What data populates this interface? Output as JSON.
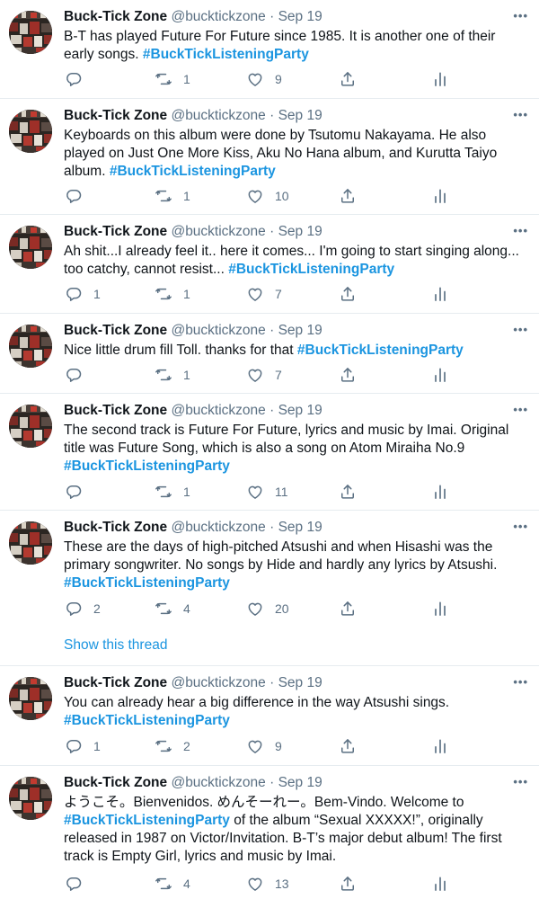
{
  "author": {
    "name": "Buck-Tick Zone",
    "handle": "@bucktickzone",
    "sep": "·",
    "more": "•••"
  },
  "tweets": [
    {
      "date": "Sep 19",
      "lines": [
        [
          {
            "t": "B-T has played Future For Future since 1985. It is another one of their"
          }
        ],
        [
          {
            "t": "early songs. "
          },
          {
            "t": "#BuckTickListeningParty",
            "h": true
          }
        ]
      ],
      "replies": "",
      "retweets": "1",
      "likes": "9"
    },
    {
      "date": "Sep 19",
      "lines": [
        [
          {
            "t": "Keyboards on this album were done by Tsutomu Nakayama. He also"
          }
        ],
        [
          {
            "t": "played on Just One More Kiss, Aku No Hana album, and Kurutta Taiyo"
          }
        ],
        [
          {
            "t": "album. "
          },
          {
            "t": "#BuckTickListeningParty",
            "h": true
          }
        ]
      ],
      "replies": "",
      "retweets": "1",
      "likes": "10"
    },
    {
      "date": "Sep 19",
      "lines": [
        [
          {
            "t": "Ah shit...I already feel it.. here it comes... I'm going to start singing along..."
          }
        ],
        [
          {
            "t": "too catchy, cannot resist... "
          },
          {
            "t": "#BuckTickListeningParty",
            "h": true
          }
        ]
      ],
      "replies": "1",
      "retweets": "1",
      "likes": "7"
    },
    {
      "date": "Sep 19",
      "lines": [
        [
          {
            "t": "Nice little drum fill Toll. thanks for that "
          },
          {
            "t": "#BuckTickListeningParty",
            "h": true
          }
        ]
      ],
      "replies": "",
      "retweets": "1",
      "likes": "7"
    },
    {
      "date": "Sep 19",
      "lines": [
        [
          {
            "t": "The second track is Future For Future, lyrics and music by Imai. Original"
          }
        ],
        [
          {
            "t": "title was Future Song, which is also a song on Atom Miraiha No.9"
          }
        ],
        [
          {
            "t": "#BuckTickListeningParty",
            "h": true
          }
        ]
      ],
      "replies": "",
      "retweets": "1",
      "likes": "11"
    },
    {
      "date": "Sep 19",
      "lines": [
        [
          {
            "t": "These are the days of high-pitched Atsushi and when Hisashi was the"
          }
        ],
        [
          {
            "t": "primary songwriter. No songs by Hide and hardly any lyrics by Atsushi."
          }
        ],
        [
          {
            "t": "#BuckTickListeningParty",
            "h": true
          }
        ]
      ],
      "replies": "2",
      "retweets": "4",
      "likes": "20",
      "show_thread": "Show this thread"
    },
    {
      "date": "Sep 19",
      "lines": [
        [
          {
            "t": "You can already hear a big difference in the way Atsushi sings."
          }
        ],
        [
          {
            "t": "#BuckTickListeningParty",
            "h": true
          }
        ]
      ],
      "replies": "1",
      "retweets": "2",
      "likes": "9"
    },
    {
      "date": "Sep 19",
      "lines": [
        [
          {
            "t": "ようこそ。Bienvenidos. めんそーれー。Bem-Vindo. Welcome to"
          }
        ],
        [
          {
            "t": "#BuckTickListeningParty",
            "h": true
          },
          {
            "t": " of the album “Sexual XXXXX!”, originally"
          }
        ],
        [
          {
            "t": "released in 1987 on Victor/Invitation. B-T’s major debut album! The first"
          }
        ],
        [
          {
            "t": "track is Empty Girl, lyrics and music by Imai."
          }
        ]
      ],
      "replies": "",
      "retweets": "4",
      "likes": "13"
    }
  ]
}
